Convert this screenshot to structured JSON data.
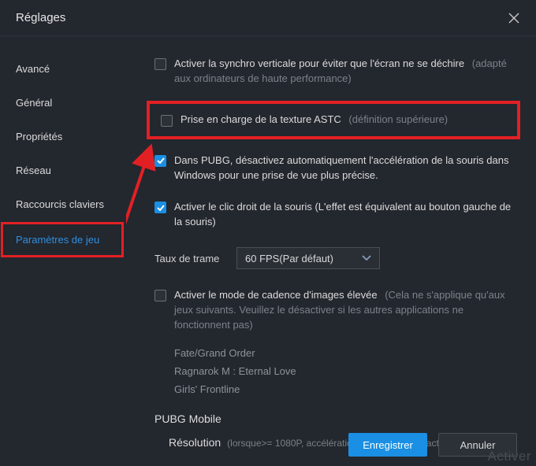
{
  "window_title": "Réglages",
  "sidebar": {
    "items": [
      {
        "label": "Avancé"
      },
      {
        "label": "Général"
      },
      {
        "label": "Propriétés"
      },
      {
        "label": "Réseau"
      },
      {
        "label": "Raccourcis claviers"
      },
      {
        "label": "Paramètres de jeu"
      }
    ]
  },
  "options": {
    "vsync": {
      "label": "Activer la synchro verticale pour éviter que l'écran ne se déchire",
      "hint": "(adapté aux ordinateurs de haute performance)"
    },
    "astc": {
      "label": "Prise en charge de la texture ASTC",
      "hint": "(définition supérieure)"
    },
    "pubg_mouse": {
      "label": "Dans PUBG, désactivez automatiquement l'accélération de la souris dans Windows pour une prise de vue plus précise."
    },
    "right_click": {
      "label": "Activer le clic droit de la souris (L'effet est équivalent au bouton gauche de la souris)"
    },
    "high_fps": {
      "label": "Activer le mode de cadence d'images élevée",
      "hint": "(Cela ne s'applique qu'aux jeux suivants. Veuillez le désactiver si les autres applications ne fonctionnent pas)"
    }
  },
  "frame_rate": {
    "label": "Taux de trame",
    "value": "60 FPS(Par défaut)"
  },
  "game_list": [
    "Fate/Grand Order",
    "Ragnarok M : Eternal Love",
    "Girls' Frontline"
  ],
  "pubg_section": {
    "title": "PUBG Mobile",
    "resolution_label": "Résolution",
    "resolution_hint": "(lorsque>= 1080P, accélération de la souris désactivée)"
  },
  "buttons": {
    "save": "Enregistrer",
    "cancel": "Annuler"
  },
  "watermark": "Activer"
}
